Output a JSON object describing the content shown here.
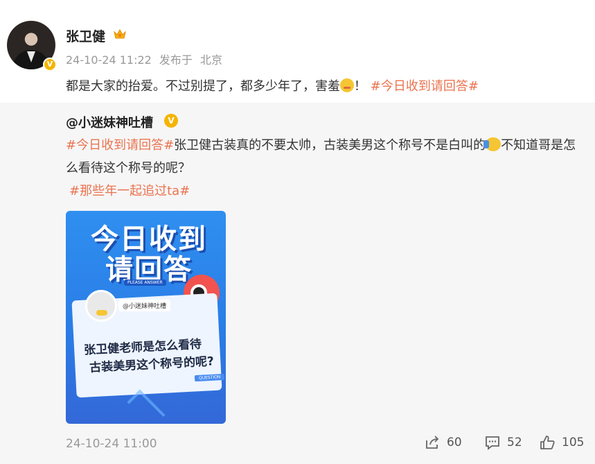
{
  "post": {
    "author": "张卫健",
    "verified_mark": "V",
    "time": "24-10-24 11:22",
    "published_label": "发布于",
    "location": "北京",
    "text": "都是大家的抬爱。不过别提了，都多少年了，害羞",
    "text_tail": "！",
    "topic": "#今日收到请回答#"
  },
  "repost": {
    "handle": "@小迷妹神吐槽",
    "badge": "V",
    "topic1": "#今日收到请回答#",
    "text_a": "张卫健古装真的不要太帅，古装美男这个称号不是白叫的",
    "text_b": "不知道哥是怎么看待这个称号的呢？",
    "topic2": "#那些年一起追过ta#",
    "card": {
      "line1": "今日收到",
      "line2": "请回答",
      "please_answer": "PLEASE ANSWER",
      "handle": "@小迷妹神吐槽",
      "question1": "张卫健老师是怎么看待",
      "question2": "古装美男这个称号的呢?",
      "question_badge": "QUESTION"
    },
    "time": "24-10-24 11:00",
    "forward_count": "60",
    "comment_count": "52",
    "like_count": "105"
  },
  "colors": {
    "topic": "#eb7350",
    "verified": "#f5b400"
  },
  "icons": [
    "verified-icon",
    "crown-icon",
    "emoji-shy-icon",
    "emoji-wave-icon",
    "forward-icon",
    "comment-icon",
    "like-icon"
  ]
}
